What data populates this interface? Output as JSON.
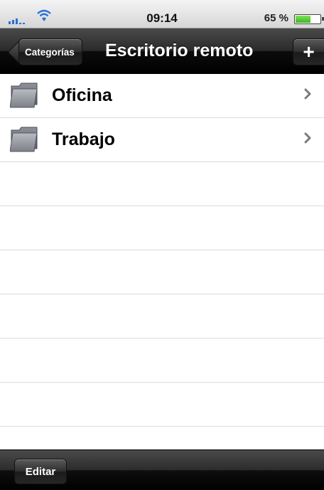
{
  "status_bar": {
    "time": "09:14",
    "battery_percent_label": "65 %",
    "battery_level": 0.65,
    "signal_icon": "signal-bars-icon",
    "wifi_icon": "wifi-icon",
    "battery_icon": "battery-icon"
  },
  "nav_bar": {
    "back_label": "Categorías",
    "title": "Escritorio remoto",
    "add_label": "+"
  },
  "table": {
    "rows": [
      {
        "label": "Oficina",
        "icon": "folder-icon",
        "accessory": "chevron-right-icon"
      },
      {
        "label": "Trabajo",
        "icon": "folder-icon",
        "accessory": "chevron-right-icon"
      }
    ]
  },
  "toolbar": {
    "edit_label": "Editar"
  },
  "colors": {
    "nav_background": "#000000",
    "battery_fill": "#3cb71f",
    "signal_blue": "#2a6fd6",
    "separator": "#dcdcdc"
  }
}
